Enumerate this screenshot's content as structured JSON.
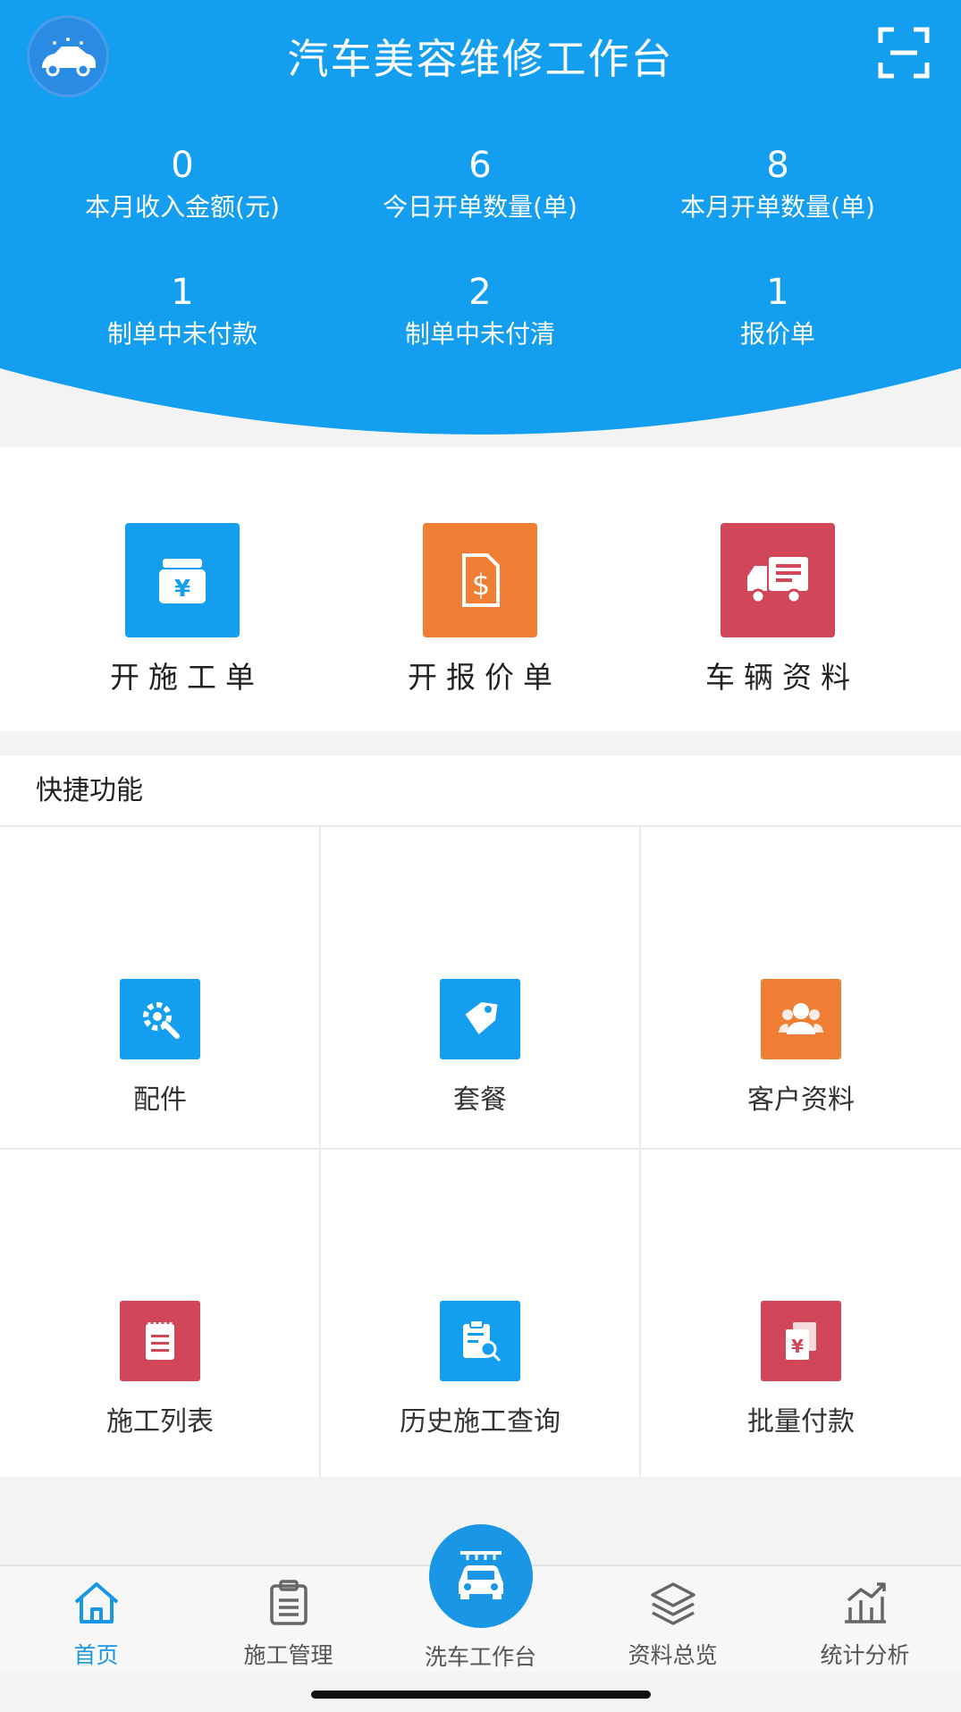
{
  "header": {
    "title": "汽车美容维修工作台",
    "logo_icon": "car-wash-logo-icon",
    "scan_icon": "scan-icon",
    "color": "#149eef"
  },
  "stats": [
    {
      "value": "0",
      "label": "本月收入金额(元)"
    },
    {
      "value": "6",
      "label": "今日开单数量(单)"
    },
    {
      "value": "8",
      "label": "本月开单数量(单)"
    },
    {
      "value": "1",
      "label": "制单中未付款"
    },
    {
      "value": "2",
      "label": "制单中未付清"
    },
    {
      "value": "1",
      "label": "报价单"
    }
  ],
  "primary_actions": [
    {
      "label": "开施工单",
      "icon": "cashier-icon",
      "color": "#149eef"
    },
    {
      "label": "开报价单",
      "icon": "dollar-document-icon",
      "color": "#f07f35"
    },
    {
      "label": "车辆资料",
      "icon": "truck-icon",
      "color": "#d14658"
    }
  ],
  "quick": {
    "title": "快捷功能",
    "items": [
      {
        "label": "配件",
        "icon": "gear-wrench-icon",
        "color": "#149eef"
      },
      {
        "label": "套餐",
        "icon": "tag-icon",
        "color": "#149eef"
      },
      {
        "label": "客户资料",
        "icon": "customers-icon",
        "color": "#f07f35"
      },
      {
        "label": "施工列表",
        "icon": "notepad-list-icon",
        "color": "#d14658"
      },
      {
        "label": "历史施工查询",
        "icon": "clipboard-search-icon",
        "color": "#149eef"
      },
      {
        "label": "批量付款",
        "icon": "batch-payment-icon",
        "color": "#d14658"
      }
    ]
  },
  "nav": {
    "items": [
      {
        "label": "首页",
        "icon": "home-icon",
        "active": true
      },
      {
        "label": "施工管理",
        "icon": "clipboard-icon",
        "active": false
      },
      {
        "label": "洗车工作台",
        "icon": "car-wash-icon",
        "active": false
      },
      {
        "label": "资料总览",
        "icon": "layers-icon",
        "active": false
      },
      {
        "label": "统计分析",
        "icon": "chart-icon",
        "active": false
      }
    ],
    "active_color": "#1a96e6"
  }
}
